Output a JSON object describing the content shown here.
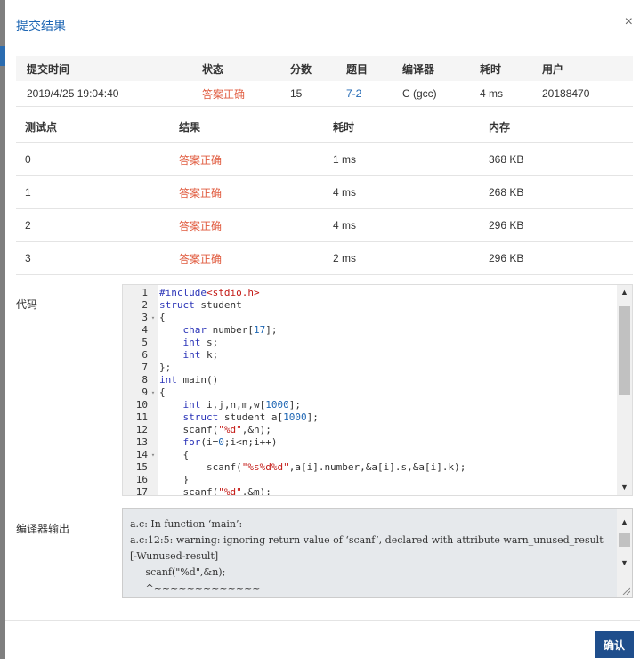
{
  "modal": {
    "title": "提交结果",
    "close": "×"
  },
  "submission": {
    "headers": [
      "提交时间",
      "状态",
      "分数",
      "题目",
      "编译器",
      "耗时",
      "用户"
    ],
    "row": {
      "time": "2019/4/25 19:04:40",
      "status": "答案正确",
      "score": "15",
      "problem": "7-2",
      "compiler": "C (gcc)",
      "elapsed": "4 ms",
      "user": "20188470"
    }
  },
  "tests": {
    "headers": [
      "测试点",
      "结果",
      "耗时",
      "内存"
    ],
    "rows": [
      {
        "id": "0",
        "result": "答案正确",
        "time": "1 ms",
        "memory": "368 KB"
      },
      {
        "id": "1",
        "result": "答案正确",
        "time": "4 ms",
        "memory": "268 KB"
      },
      {
        "id": "2",
        "result": "答案正确",
        "time": "4 ms",
        "memory": "296 KB"
      },
      {
        "id": "3",
        "result": "答案正确",
        "time": "2 ms",
        "memory": "296 KB"
      }
    ]
  },
  "code": {
    "label": "代码",
    "line_numbers": [
      "1",
      "2",
      "3",
      "4",
      "5",
      "6",
      "7",
      "8",
      "9",
      "10",
      "11",
      "12",
      "13",
      "14",
      "15",
      "16",
      "17"
    ],
    "lines": [
      "#include<stdio.h>",
      "struct student",
      "{",
      "    char number[17];",
      "    int s;",
      "    int k;",
      "};",
      "int main()",
      "{",
      "    int i,j,n,m,w[1000];",
      "    struct student a[1000];",
      "    scanf(\"%d\",&n);",
      "    for(i=0;i<n;i++)",
      "    {",
      "        scanf(\"%s%d%d\",a[i].number,&a[i].s,&a[i].k);",
      "    }",
      "    scanf(\"%d\",&m);"
    ]
  },
  "compiler_output": {
    "label": "编译器输出",
    "text": "a.c: In function ‘main’:\na.c:12:5: warning: ignoring return value of ‘scanf’, declared with attribute warn_unused_result [-Wunused-result]\n     scanf(\"%d\",&n);\n     ^~~~~~~~~~~~~~"
  },
  "footer": {
    "confirm": "确认"
  },
  "icons": {
    "scroll_up": "scroll-up-arrow-icon",
    "scroll_down": "scroll-down-arrow-icon",
    "fold": "fold-triangle-icon",
    "close": "close-icon"
  },
  "colors": {
    "accent": "#1f67b4",
    "accepted": "#e05b3f",
    "button": "#1f4e8c"
  }
}
